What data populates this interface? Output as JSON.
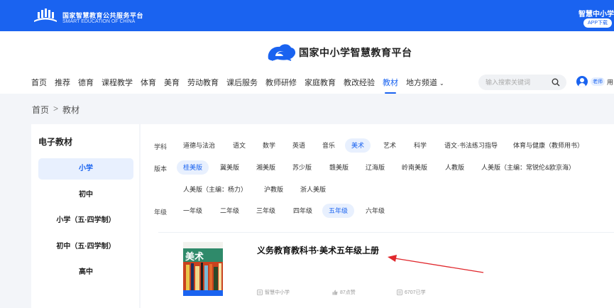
{
  "topbar": {
    "org_name_cn": "国家智慧教育公共服务平台",
    "org_name_en": "SMART EDUCATION OF CHINA",
    "app_name": "智慧中小学",
    "app_download": "APP下载"
  },
  "brand": {
    "name": "国家中小学智慧教育平台"
  },
  "nav": {
    "items": [
      {
        "label": "首页",
        "active": false
      },
      {
        "label": "推荐",
        "active": false
      },
      {
        "label": "德育",
        "active": false
      },
      {
        "label": "课程教学",
        "active": false
      },
      {
        "label": "体育",
        "active": false
      },
      {
        "label": "美育",
        "active": false
      },
      {
        "label": "劳动教育",
        "active": false
      },
      {
        "label": "课后服务",
        "active": false
      },
      {
        "label": "教师研修",
        "active": false
      },
      {
        "label": "家庭教育",
        "active": false
      },
      {
        "label": "教改经验",
        "active": false
      },
      {
        "label": "教材",
        "active": true
      },
      {
        "label": "地方频道",
        "active": false
      }
    ]
  },
  "search": {
    "placeholder": "输入搜索关键词"
  },
  "user": {
    "role": "老师",
    "name": "用"
  },
  "breadcrumb": {
    "home": "首页",
    "separator": ">",
    "current": "教材"
  },
  "sidebar": {
    "title": "电子教材",
    "items": [
      {
        "label": "小学",
        "active": true
      },
      {
        "label": "初中",
        "active": false
      },
      {
        "label": "小学（五·四学制）",
        "active": false
      },
      {
        "label": "初中（五·四学制）",
        "active": false
      },
      {
        "label": "高中",
        "active": false
      }
    ]
  },
  "filters": {
    "subject_label": "学科",
    "subjects": [
      "道德与法治",
      "语文",
      "数学",
      "英语",
      "音乐",
      "美术",
      "艺术",
      "科学",
      "语文·书法练习指导",
      "体育与健康（教师用书）"
    ],
    "subject_active": "美术",
    "edition_label": "版本",
    "editions": [
      "桂美版",
      "冀美版",
      "湘美版",
      "苏少版",
      "赣美版",
      "辽海版",
      "岭南美版",
      "人教版",
      "人美版（主编：常锐伦&欧京海）",
      "人美版（主编：杨力）",
      "沪教版",
      "浙人美版"
    ],
    "edition_active": "桂美版",
    "grade_label": "年级",
    "grades": [
      "一年级",
      "二年级",
      "三年级",
      "四年级",
      "五年级",
      "六年级"
    ],
    "grade_active": "五年级"
  },
  "book": {
    "cover_title": "美术",
    "title": "义务教育教科书·美术五年级上册",
    "publisher": "智慧中小学",
    "likes": "87点赞",
    "views": "6707已学"
  },
  "colors": {
    "primary": "#1a63f0",
    "active_bg": "#e8f0fe",
    "page_bg": "#f3f5f9",
    "annotation_arrow": "#e0282d"
  }
}
